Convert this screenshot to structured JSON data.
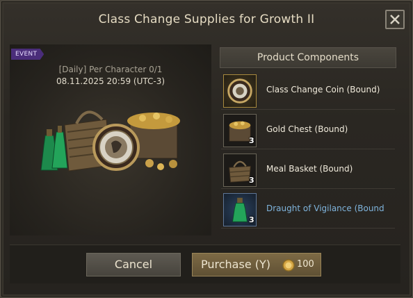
{
  "dialog": {
    "title": "Class Change Supplies for Growth II",
    "event_badge": "EVENT",
    "limit_text": "[Daily] Per Character 0/1",
    "date_text": "08.11.2025 20:59 (UTC-3)"
  },
  "components": {
    "header": "Product Components",
    "items": [
      {
        "name": "Class Change Coin (Bound)",
        "qty": "",
        "icon": "coin-icon",
        "style": "gold"
      },
      {
        "name": "Gold Chest (Bound)",
        "qty": "3",
        "icon": "chest-icon",
        "style": "normal"
      },
      {
        "name": "Meal Basket (Bound)",
        "qty": "3",
        "icon": "basket-icon",
        "style": "normal"
      },
      {
        "name": "Draught of Vigilance (Bound",
        "qty": "3",
        "icon": "potion-icon",
        "style": "blue"
      }
    ]
  },
  "footer": {
    "cancel_label": "Cancel",
    "purchase_label": "Purchase (Y)",
    "price": "100"
  },
  "colors": {
    "title": "#e6dcc3",
    "event_badge": "#4a2d7a",
    "blue_item_text": "#7fb4dc",
    "purchase_button": "#7d6a45"
  }
}
